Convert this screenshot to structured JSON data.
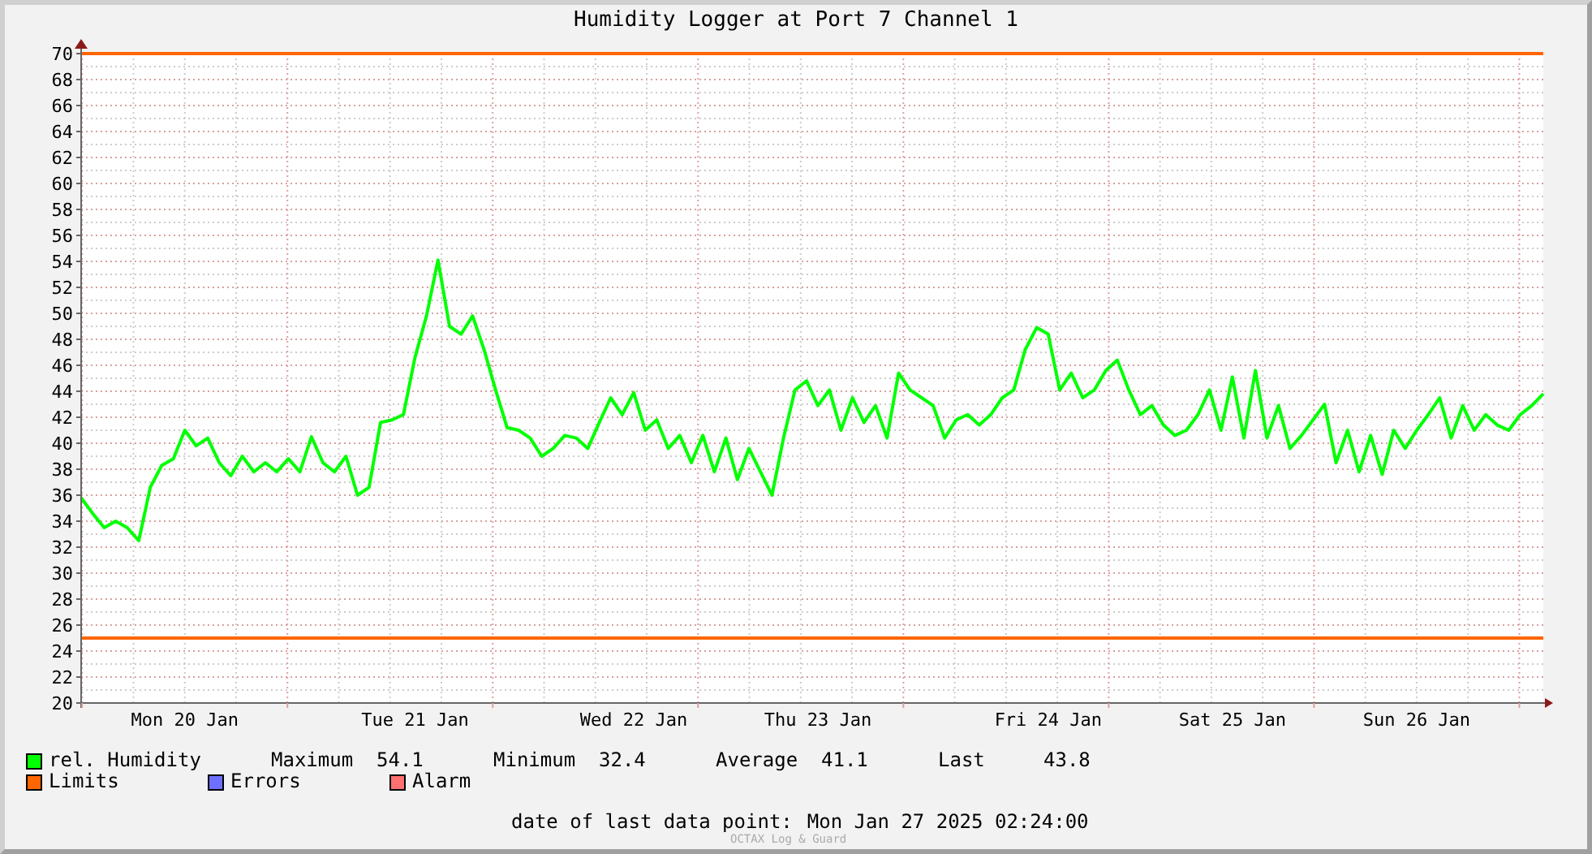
{
  "title": "Humidity Logger at Port 7 Channel 1",
  "chart_data": {
    "type": "line",
    "ylim": [
      20,
      70
    ],
    "yticks": [
      20,
      22,
      24,
      26,
      28,
      30,
      32,
      34,
      36,
      38,
      40,
      42,
      44,
      46,
      48,
      50,
      52,
      54,
      56,
      58,
      60,
      62,
      64,
      66,
      68,
      70
    ],
    "categories": [
      null,
      null,
      null,
      null,
      null,
      null,
      null,
      null,
      null,
      "Mon 20 Jan",
      null,
      null,
      null,
      null,
      null,
      null,
      null,
      null,
      null,
      null,
      null,
      null,
      null,
      null,
      null,
      null,
      null,
      null,
      null,
      "Tue 21 Jan",
      null,
      null,
      null,
      null,
      null,
      null,
      null,
      null,
      null,
      null,
      null,
      null,
      null,
      null,
      null,
      null,
      null,
      null,
      "Wed 22 Jan",
      null,
      null,
      null,
      null,
      null,
      null,
      null,
      null,
      null,
      null,
      null,
      null,
      null,
      null,
      null,
      "Thu 23 Jan",
      null,
      null,
      null,
      null,
      null,
      null,
      null,
      null,
      null,
      null,
      null,
      null,
      null,
      null,
      null,
      null,
      null,
      null,
      null,
      "Fri 24 Jan",
      null,
      null,
      null,
      null,
      null,
      null,
      null,
      null,
      null,
      null,
      null,
      null,
      null,
      null,
      null,
      "Sat 25 Jan",
      null,
      null,
      null,
      null,
      null,
      null,
      null,
      null,
      null,
      null,
      null,
      null,
      null,
      null,
      null,
      "Sun 26 Jan",
      null,
      null,
      null,
      null,
      null,
      null,
      null,
      null,
      null,
      null,
      null
    ],
    "series": [
      {
        "name": "rel. Humidity",
        "color": "#00ff00",
        "values": [
          35.8,
          34.6,
          33.5,
          34,
          33.5,
          32.5,
          36.6,
          38.3,
          38.8,
          41,
          39.8,
          40.4,
          38.5,
          37.5,
          39,
          37.8,
          38.5,
          37.8,
          38.8,
          37.8,
          40.5,
          38.5,
          37.8,
          39,
          36,
          36.6,
          41.6,
          41.8,
          42.2,
          46.6,
          49.8,
          54.1,
          49,
          48.4,
          49.8,
          47.2,
          44.1,
          41.2,
          41,
          40.4,
          39,
          39.6,
          40.6,
          40.4,
          39.6,
          41.6,
          43.5,
          42.2,
          43.9,
          41,
          41.8,
          39.6,
          40.6,
          38.5,
          40.6,
          37.8,
          40.4,
          37.2,
          39.6,
          37.8,
          36,
          40.4,
          44.1,
          44.8,
          42.9,
          44.1,
          41,
          43.5,
          41.6,
          42.9,
          40.4,
          45.4,
          44.1,
          43.5,
          42.9,
          40.4,
          41.8,
          42.2,
          41.4,
          42.2,
          43.5,
          44.1,
          47.2,
          48.9,
          48.4,
          44.1,
          45.4,
          43.5,
          44.1,
          45.6,
          46.4,
          44.1,
          42.2,
          42.9,
          41.4,
          40.6,
          41,
          42.2,
          44.1,
          41,
          45.1,
          40.4,
          45.6,
          40.4,
          42.9,
          39.6,
          40.6,
          41.8,
          43,
          38.5,
          41,
          37.8,
          40.6,
          37.6,
          41,
          39.6,
          41,
          42.2,
          43.5,
          40.4,
          42.9,
          41,
          42.2,
          41.4,
          41,
          42.2,
          42.9,
          43.8
        ]
      }
    ],
    "grid": true,
    "ref_lines": [
      {
        "axis": "y",
        "value": 70,
        "color": "#ff6600"
      },
      {
        "axis": "y",
        "value": 25,
        "color": "#ff6600"
      }
    ]
  },
  "legend": {
    "stats": [
      {
        "label": "Maximum",
        "value": "54.1"
      },
      {
        "label": "Minimum",
        "value": "32.4"
      },
      {
        "label": "Average",
        "value": "41.1"
      },
      {
        "label": "Last",
        "value": "43.8"
      }
    ],
    "items": [
      {
        "label": "Limits",
        "color": "#ff6600"
      },
      {
        "label": "Errors",
        "color": "#6f6fff"
      },
      {
        "label": "Alarm",
        "color": "#ff7070"
      }
    ]
  },
  "last_data_point": {
    "label": "date of last data point:",
    "value": "Mon Jan 27 2025 02:24:00"
  },
  "credit": "OCTAX Log & Guard"
}
